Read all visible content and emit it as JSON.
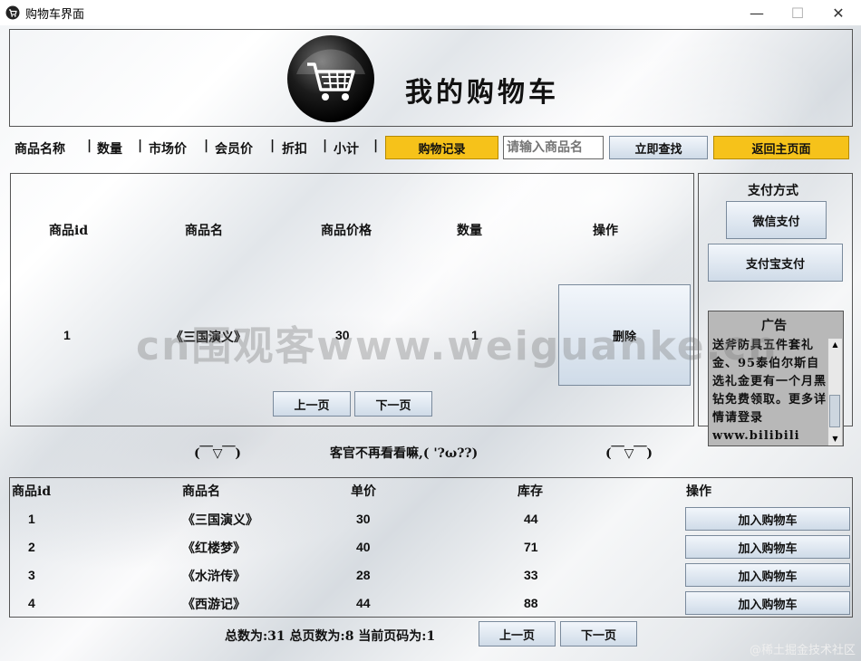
{
  "window": {
    "title": "购物车界面",
    "minimize": "—",
    "maximize": "☐",
    "close": "✕"
  },
  "header": {
    "title": "我的购物车"
  },
  "toolbar": {
    "columns": [
      "商品名称",
      "数量",
      "市场价",
      "会员价",
      "折扣",
      "小计"
    ],
    "separator": "|",
    "history_button": "购物记录",
    "search_placeholder": "请输入商品名",
    "search_button": "立即查找",
    "home_button": "返回主页面"
  },
  "cart": {
    "headers": [
      "商品id",
      "商品名",
      "商品价格",
      "数量",
      "操作"
    ],
    "rows": [
      {
        "id": "1",
        "name": "《三国演义》",
        "price": "30",
        "qty": "1",
        "action": "删除"
      }
    ],
    "prev": "上一页",
    "next": "下一页"
  },
  "payment": {
    "title": "支付方式",
    "wechat": "微信支付",
    "alipay": "支付宝支付",
    "ad_title": "广告",
    "ad_text": "送斧防具五件套礼金、95泰伯尔斯自选礼金更有一个月黑钻免费领取。更多详情请登录www.bilibili"
  },
  "banner": {
    "left": "(￣▽￣)",
    "middle": "客官不再看看嘛,( '?ω??)",
    "right": "(￣▽￣)"
  },
  "products": {
    "headers": [
      "商品id",
      "商品名",
      "单价",
      "库存",
      "操作"
    ],
    "rows": [
      {
        "id": "1",
        "name": "《三国演义》",
        "price": "30",
        "stock": "44",
        "action": "加入购物车"
      },
      {
        "id": "2",
        "name": "《红楼梦》",
        "price": "40",
        "stock": "71",
        "action": "加入购物车"
      },
      {
        "id": "3",
        "name": "《水浒传》",
        "price": "28",
        "stock": "33",
        "action": "加入购物车"
      },
      {
        "id": "4",
        "name": "《西游记》",
        "price": "44",
        "stock": "88",
        "action": "加入购物车"
      }
    ],
    "summary": "总数为:31 总页数为:8 当前页码为:1",
    "prev": "上一页",
    "next": "下一页"
  },
  "watermarks": {
    "center": "cn围观客www.weiguanke.cn",
    "corner": "@稀土掘金技术社区"
  },
  "colors": {
    "accent_yellow": "#f6c21a",
    "button_blue": "#cfdbe8"
  }
}
